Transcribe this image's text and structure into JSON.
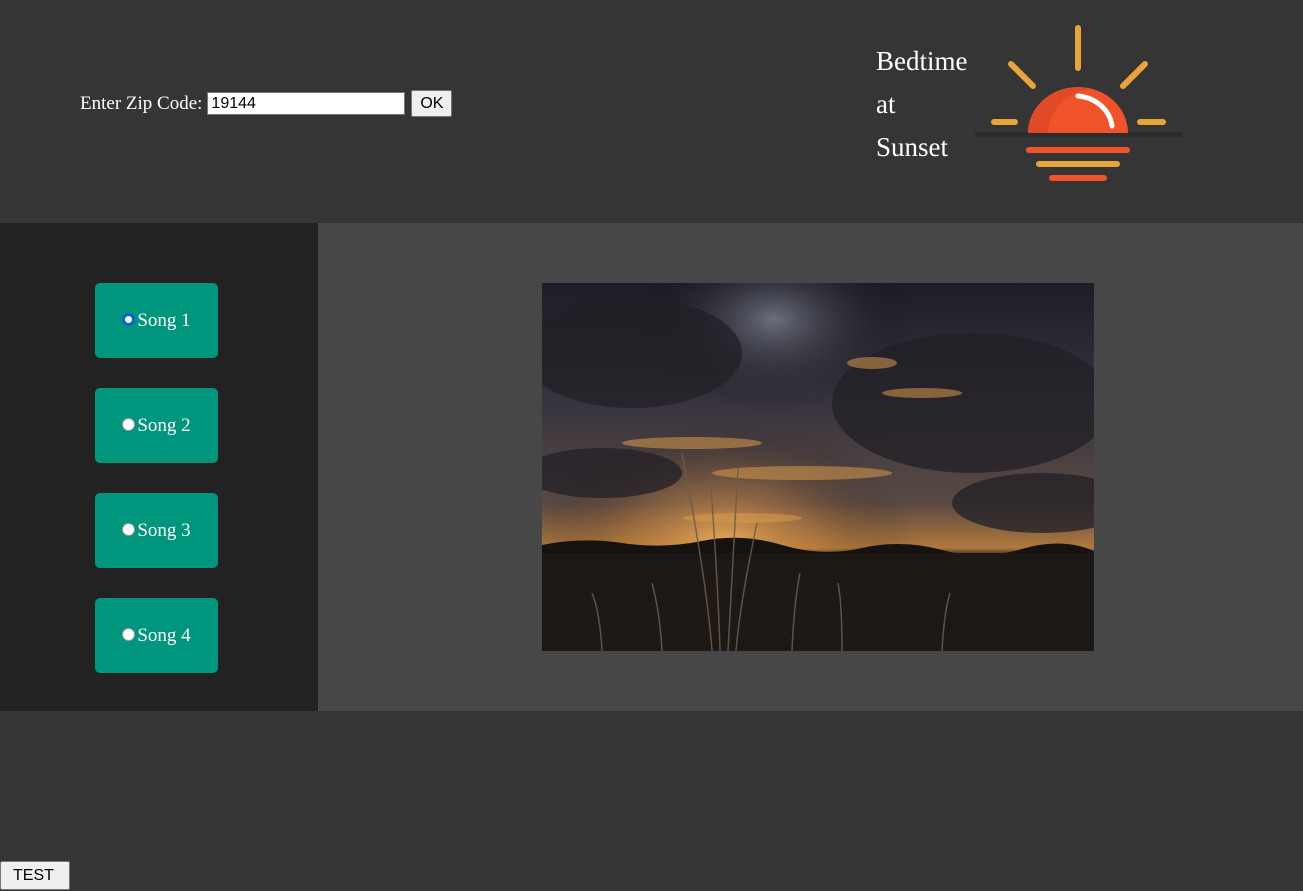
{
  "header": {
    "zip_label": "Enter Zip Code:",
    "zip_value": "19144",
    "ok_label": "OK",
    "title_lines": [
      "Bedtime",
      "at",
      "Sunset"
    ]
  },
  "logo": {
    "icon": "sunset-icon",
    "colors": {
      "sun": "#f0532a",
      "rays": "#e9a43a"
    }
  },
  "songs": [
    {
      "label": "Song 1",
      "checked": true
    },
    {
      "label": "Song 2",
      "checked": false
    },
    {
      "label": "Song 3",
      "checked": false
    },
    {
      "label": "Song 4",
      "checked": false
    }
  ],
  "footer": {
    "test_label": "TEST"
  },
  "colors": {
    "song_button": "#00967d",
    "radio_selected": "#0b63d8"
  }
}
